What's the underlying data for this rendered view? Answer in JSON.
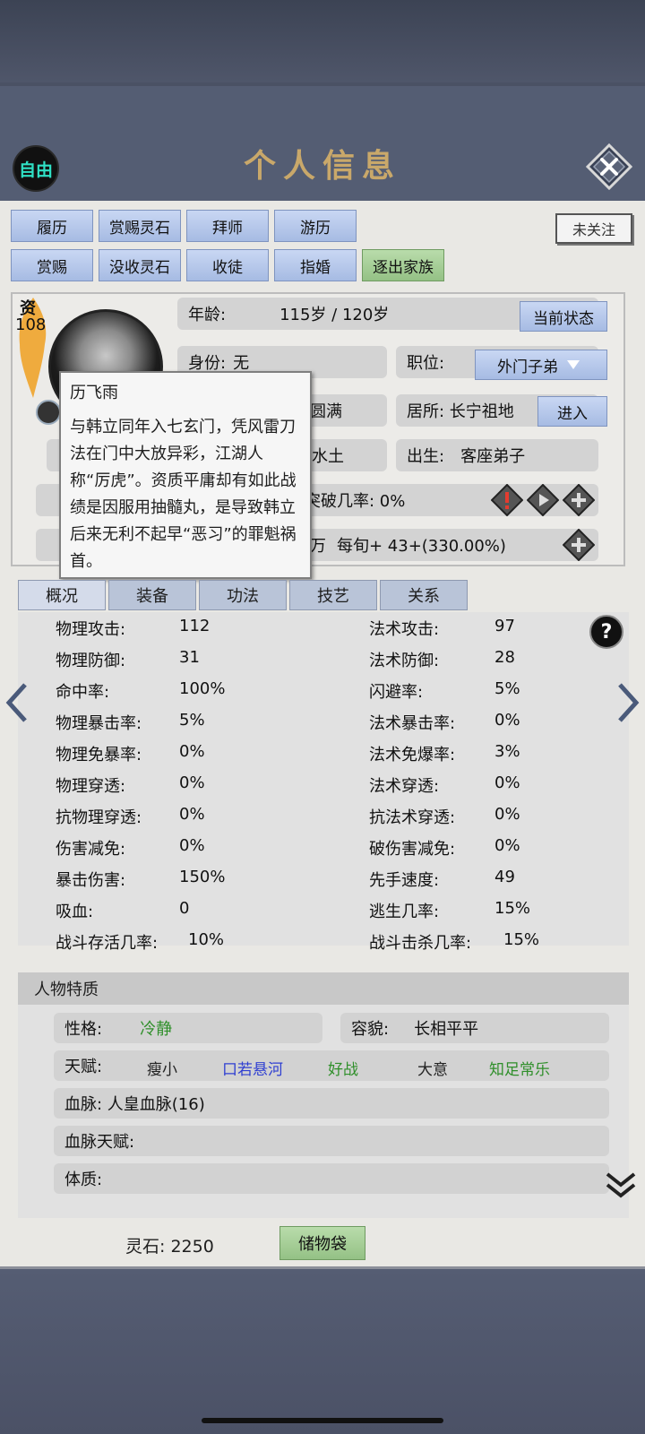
{
  "header": {
    "title": "个人信息",
    "freedom_badge": "自由",
    "follow_label": "未关注"
  },
  "action_buttons": [
    {
      "label": "履历",
      "style": "blue"
    },
    {
      "label": "赏赐灵石",
      "style": "blue"
    },
    {
      "label": "拜师",
      "style": "blue"
    },
    {
      "label": "游历",
      "style": "blue"
    },
    {
      "label": "赏赐",
      "style": "blue"
    },
    {
      "label": "没收灵石",
      "style": "blue"
    },
    {
      "label": "收徒",
      "style": "blue"
    },
    {
      "label": "指婚",
      "style": "blue"
    },
    {
      "label": "逐出家族",
      "style": "green"
    }
  ],
  "profile": {
    "tier_label": "资",
    "tier_value": "108",
    "age_label": "年龄:",
    "age_value": "115岁 / 120岁",
    "status_button": "当前状态",
    "identity_label": "身份:",
    "identity_value": "无",
    "position_label": "职位:",
    "position_value": "外门子弟",
    "realm_fragment": "圆满",
    "residence_label": "居所: 长宁祖地",
    "enter_button": "进入",
    "root_fragment": "水土",
    "origin_label": "出生:",
    "origin_value": "客座弟子",
    "breakthrough_fragment": "突破几率: 0%",
    "cultivation_fragment": "万",
    "cultivation_rate": "每旬+   43+(330.00%)"
  },
  "tooltip": {
    "name": "历飞雨",
    "description": "与韩立同年入七玄门，凭风雷刀法在门中大放异彩，江湖人称“厉虎”。资质平庸却有如此战绩是因服用抽髓丸，是导致韩立后来无利不起早“恶习”的罪魁祸首。"
  },
  "tabs": [
    "概况",
    "装备",
    "功法",
    "技艺",
    "关系"
  ],
  "stats_left": [
    {
      "label": "物理攻击:",
      "value": "112"
    },
    {
      "label": "物理防御:",
      "value": "31"
    },
    {
      "label": "命中率:",
      "value": "100%"
    },
    {
      "label": "物理暴击率:",
      "value": "5%"
    },
    {
      "label": "物理免暴率:",
      "value": "0%"
    },
    {
      "label": "物理穿透:",
      "value": "0%"
    },
    {
      "label": "抗物理穿透:",
      "value": "0%"
    },
    {
      "label": "伤害减免:",
      "value": "0%"
    },
    {
      "label": "暴击伤害:",
      "value": "150%"
    },
    {
      "label": "吸血:",
      "value": "0"
    },
    {
      "label": "战斗存活几率:",
      "value": "10%"
    }
  ],
  "stats_right": [
    {
      "label": "法术攻击:",
      "value": "97"
    },
    {
      "label": "法术防御:",
      "value": "28"
    },
    {
      "label": "闪避率:",
      "value": "5%"
    },
    {
      "label": "法术暴击率:",
      "value": "0%"
    },
    {
      "label": "法术免爆率:",
      "value": "3%"
    },
    {
      "label": "法术穿透:",
      "value": "0%"
    },
    {
      "label": "抗法术穿透:",
      "value": "0%"
    },
    {
      "label": "破伤害减免:",
      "value": "0%"
    },
    {
      "label": "先手速度:",
      "value": "49"
    },
    {
      "label": "逃生几率:",
      "value": "15%"
    },
    {
      "label": "战斗击杀几率:",
      "value": "15%"
    }
  ],
  "traits": {
    "header": "人物特质",
    "personality_label": "性格:",
    "personality_value": "冷静",
    "appearance_label": "容貌:",
    "appearance_value": "长相平平",
    "talent_label": "天赋:",
    "talents": [
      {
        "name": "瘦小",
        "color": "#222222"
      },
      {
        "name": "口若悬河",
        "color": "#2f3fd1"
      },
      {
        "name": "好战",
        "color": "#2f8f2a"
      },
      {
        "name": "大意",
        "color": "#222222"
      },
      {
        "name": "知足常乐",
        "color": "#2f8f2a"
      }
    ],
    "bloodline_label": "血脉: 人皇血脉(16)",
    "bloodline_talent_label": "血脉天赋:",
    "physique_label": "体质:"
  },
  "footer": {
    "spirit_stones": "灵石: 2250",
    "bag_button": "储物袋"
  },
  "colors": {
    "title_gold": "#c9a86a",
    "badge_cyan": "#2fe0c5",
    "header_bg": "#545d73"
  }
}
